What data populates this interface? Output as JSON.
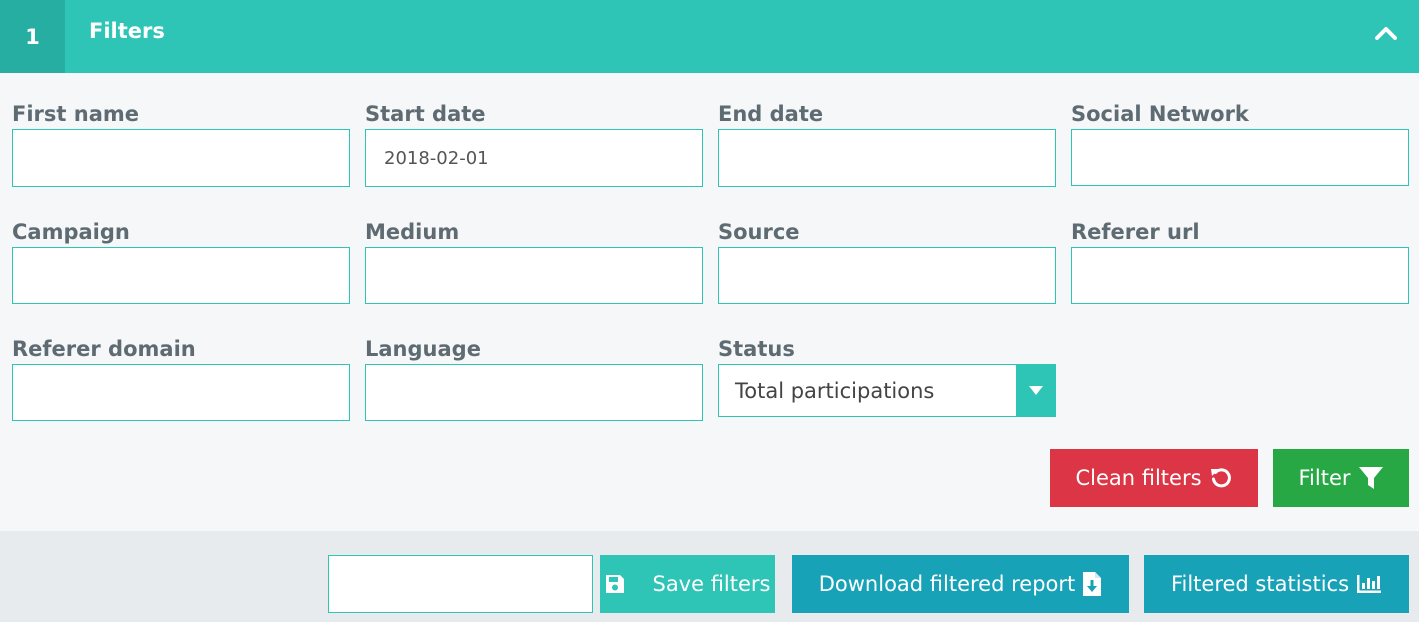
{
  "header": {
    "step": "1",
    "title": "Filters"
  },
  "filters": {
    "first_name": {
      "label": "First name",
      "value": ""
    },
    "start_date": {
      "label": "Start date",
      "value": "2018-02-01"
    },
    "end_date": {
      "label": "End date",
      "value": ""
    },
    "social_network": {
      "label": "Social Network",
      "value": ""
    },
    "campaign": {
      "label": "Campaign",
      "value": ""
    },
    "medium": {
      "label": "Medium",
      "value": ""
    },
    "source": {
      "label": "Source",
      "value": ""
    },
    "referer_url": {
      "label": "Referer url",
      "value": ""
    },
    "referer_domain": {
      "label": "Referer domain",
      "value": ""
    },
    "language": {
      "label": "Language",
      "value": ""
    },
    "status": {
      "label": "Status",
      "selected": "Total participations"
    }
  },
  "actions": {
    "clean_filters": "Clean filters",
    "filter": "Filter"
  },
  "footer": {
    "filter_name_value": "",
    "save_filters": "Save filters",
    "download_report": "Download filtered report",
    "filtered_statistics": "Filtered statistics"
  },
  "colors": {
    "accent": "#2ec4b6",
    "danger": "#dc3545",
    "success": "#28a745",
    "info": "#17a2b8"
  },
  "icons": {
    "collapse": "chevron-up-icon",
    "select_arrow": "caret-down-icon",
    "clean": "undo-icon",
    "filter": "funnel-icon",
    "save": "floppy-disk-icon",
    "download": "file-download-icon",
    "statistics": "bar-chart-icon"
  }
}
